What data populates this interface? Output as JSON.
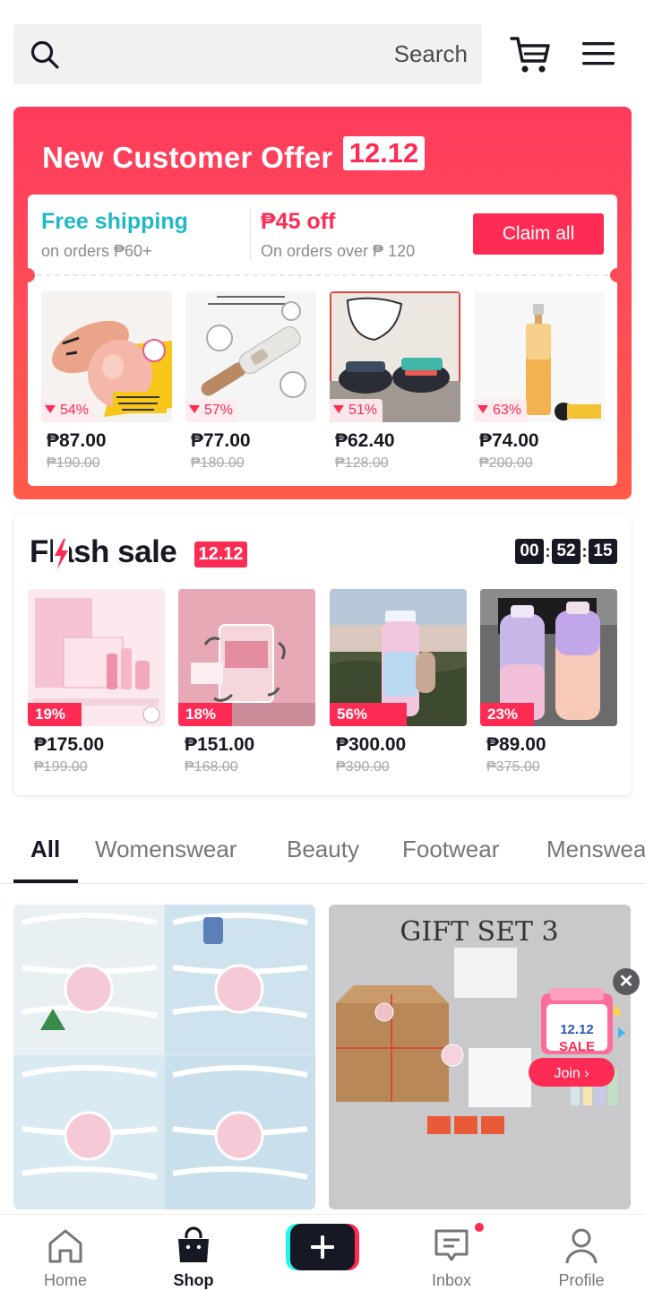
{
  "search": {
    "placeholder": "Search"
  },
  "offer": {
    "title": "New Customer Offer",
    "badge": "12.12",
    "free_shipping_title": "Free shipping",
    "free_shipping_sub": "on orders ₱60+",
    "discount_title": "₱45 off",
    "discount_sub": "On orders over ₱ 120",
    "claim_label": "Claim all",
    "products": [
      {
        "discount": "54%",
        "price": "₱87.00",
        "old_price": "₱190.00"
      },
      {
        "discount": "57%",
        "price": "₱77.00",
        "old_price": "₱180.00"
      },
      {
        "discount": "51%",
        "price": "₱62.40",
        "old_price": "₱128.00"
      },
      {
        "discount": "63%",
        "price": "₱74.00",
        "old_price": "₱200.00"
      }
    ]
  },
  "flash": {
    "title": "Flash sale",
    "badge": "12.12",
    "timer": {
      "hours": "00",
      "minutes": "52",
      "seconds": "15"
    },
    "products": [
      {
        "discount": "19%",
        "price": "₱175.00",
        "old_price": "₱199.00"
      },
      {
        "discount": "18%",
        "price": "₱151.00",
        "old_price": "₱168.00"
      },
      {
        "discount": "56%",
        "price": "₱300.00",
        "old_price": "₱390.00"
      },
      {
        "discount": "23%",
        "price": "₱89.00",
        "old_price": "₱375.00"
      }
    ]
  },
  "tabs": [
    "All",
    "Womenswear",
    "Beauty",
    "Footwear",
    "Menswear"
  ],
  "feed": {
    "card2_text": "GIFT SET 3",
    "promo": {
      "line1": "12.12",
      "line2": "SALE",
      "join": "Join ›"
    },
    "close": "✕"
  },
  "nav": {
    "home": "Home",
    "shop": "Shop",
    "inbox": "Inbox",
    "profile": "Profile"
  },
  "colors": {
    "brand_red": "#fe2c55",
    "teal": "#20b8c8",
    "text_dark": "#161823"
  }
}
